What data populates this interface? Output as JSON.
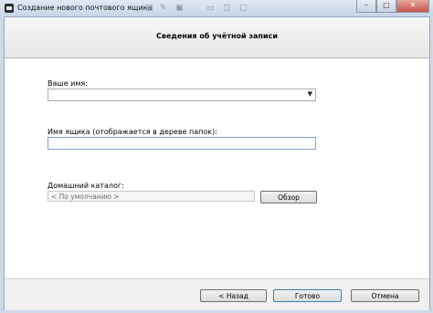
{
  "window": {
    "title": "Создание нового почтового ящика",
    "close_glyph": "✕",
    "minimize_glyph": "–",
    "maximize_glyph": "□"
  },
  "header": {
    "title": "Сведения об учётной записи"
  },
  "form": {
    "name_label": "Ваше имя:",
    "name_value": "",
    "mailbox_label": "Имя ящика (отображается в дереве папок):",
    "mailbox_value": "",
    "home_dir_label": "Домашний каталог:",
    "home_dir_value": "< По умолчанию >",
    "browse_label": "Обзор"
  },
  "footer": {
    "back_label": "< Назад",
    "finish_label": "Готово",
    "cancel_label": "Отмена"
  },
  "icons": {
    "app": "mail-app-icon",
    "dropdown": "chevron-down-icon"
  }
}
